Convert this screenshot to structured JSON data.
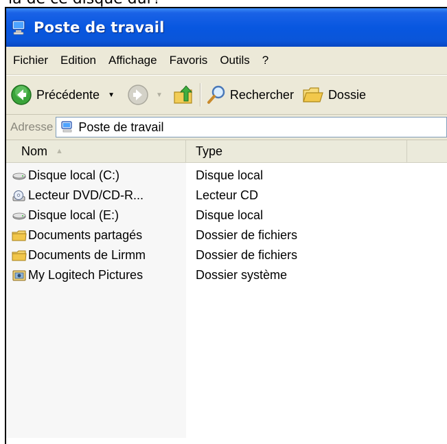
{
  "cropped_text": "ia de ce disque dur?",
  "window": {
    "title": "Poste de travail",
    "title_icon": "my-computer-icon"
  },
  "menu": [
    "Fichier",
    "Edition",
    "Affichage",
    "Favoris",
    "Outils",
    "?"
  ],
  "toolbar": {
    "back_label": "Précédente",
    "search_label": "Rechercher",
    "folders_label": "Dossie"
  },
  "address": {
    "label": "Adresse",
    "value": "Poste de travail"
  },
  "columns": {
    "name": "Nom",
    "type": "Type"
  },
  "items": [
    {
      "name": "Disque local (C:)",
      "type": "Disque local",
      "icon": "hard-drive-icon"
    },
    {
      "name": "Lecteur DVD/CD-R...",
      "type": "Lecteur CD",
      "icon": "cd-drive-icon"
    },
    {
      "name": "Disque local (E:)",
      "type": "Disque local",
      "icon": "hard-drive-icon"
    },
    {
      "name": "Documents partagés",
      "type": "Dossier de fichiers",
      "icon": "folder-icon"
    },
    {
      "name": "Documents de Lirmm",
      "type": "Dossier de fichiers",
      "icon": "folder-icon"
    },
    {
      "name": "My Logitech Pictures",
      "type": "Dossier système",
      "icon": "camera-folder-icon"
    }
  ],
  "colors": {
    "title_bar": "#0857e0",
    "chrome": "#ece9d8",
    "address_border": "#7f9db9"
  }
}
